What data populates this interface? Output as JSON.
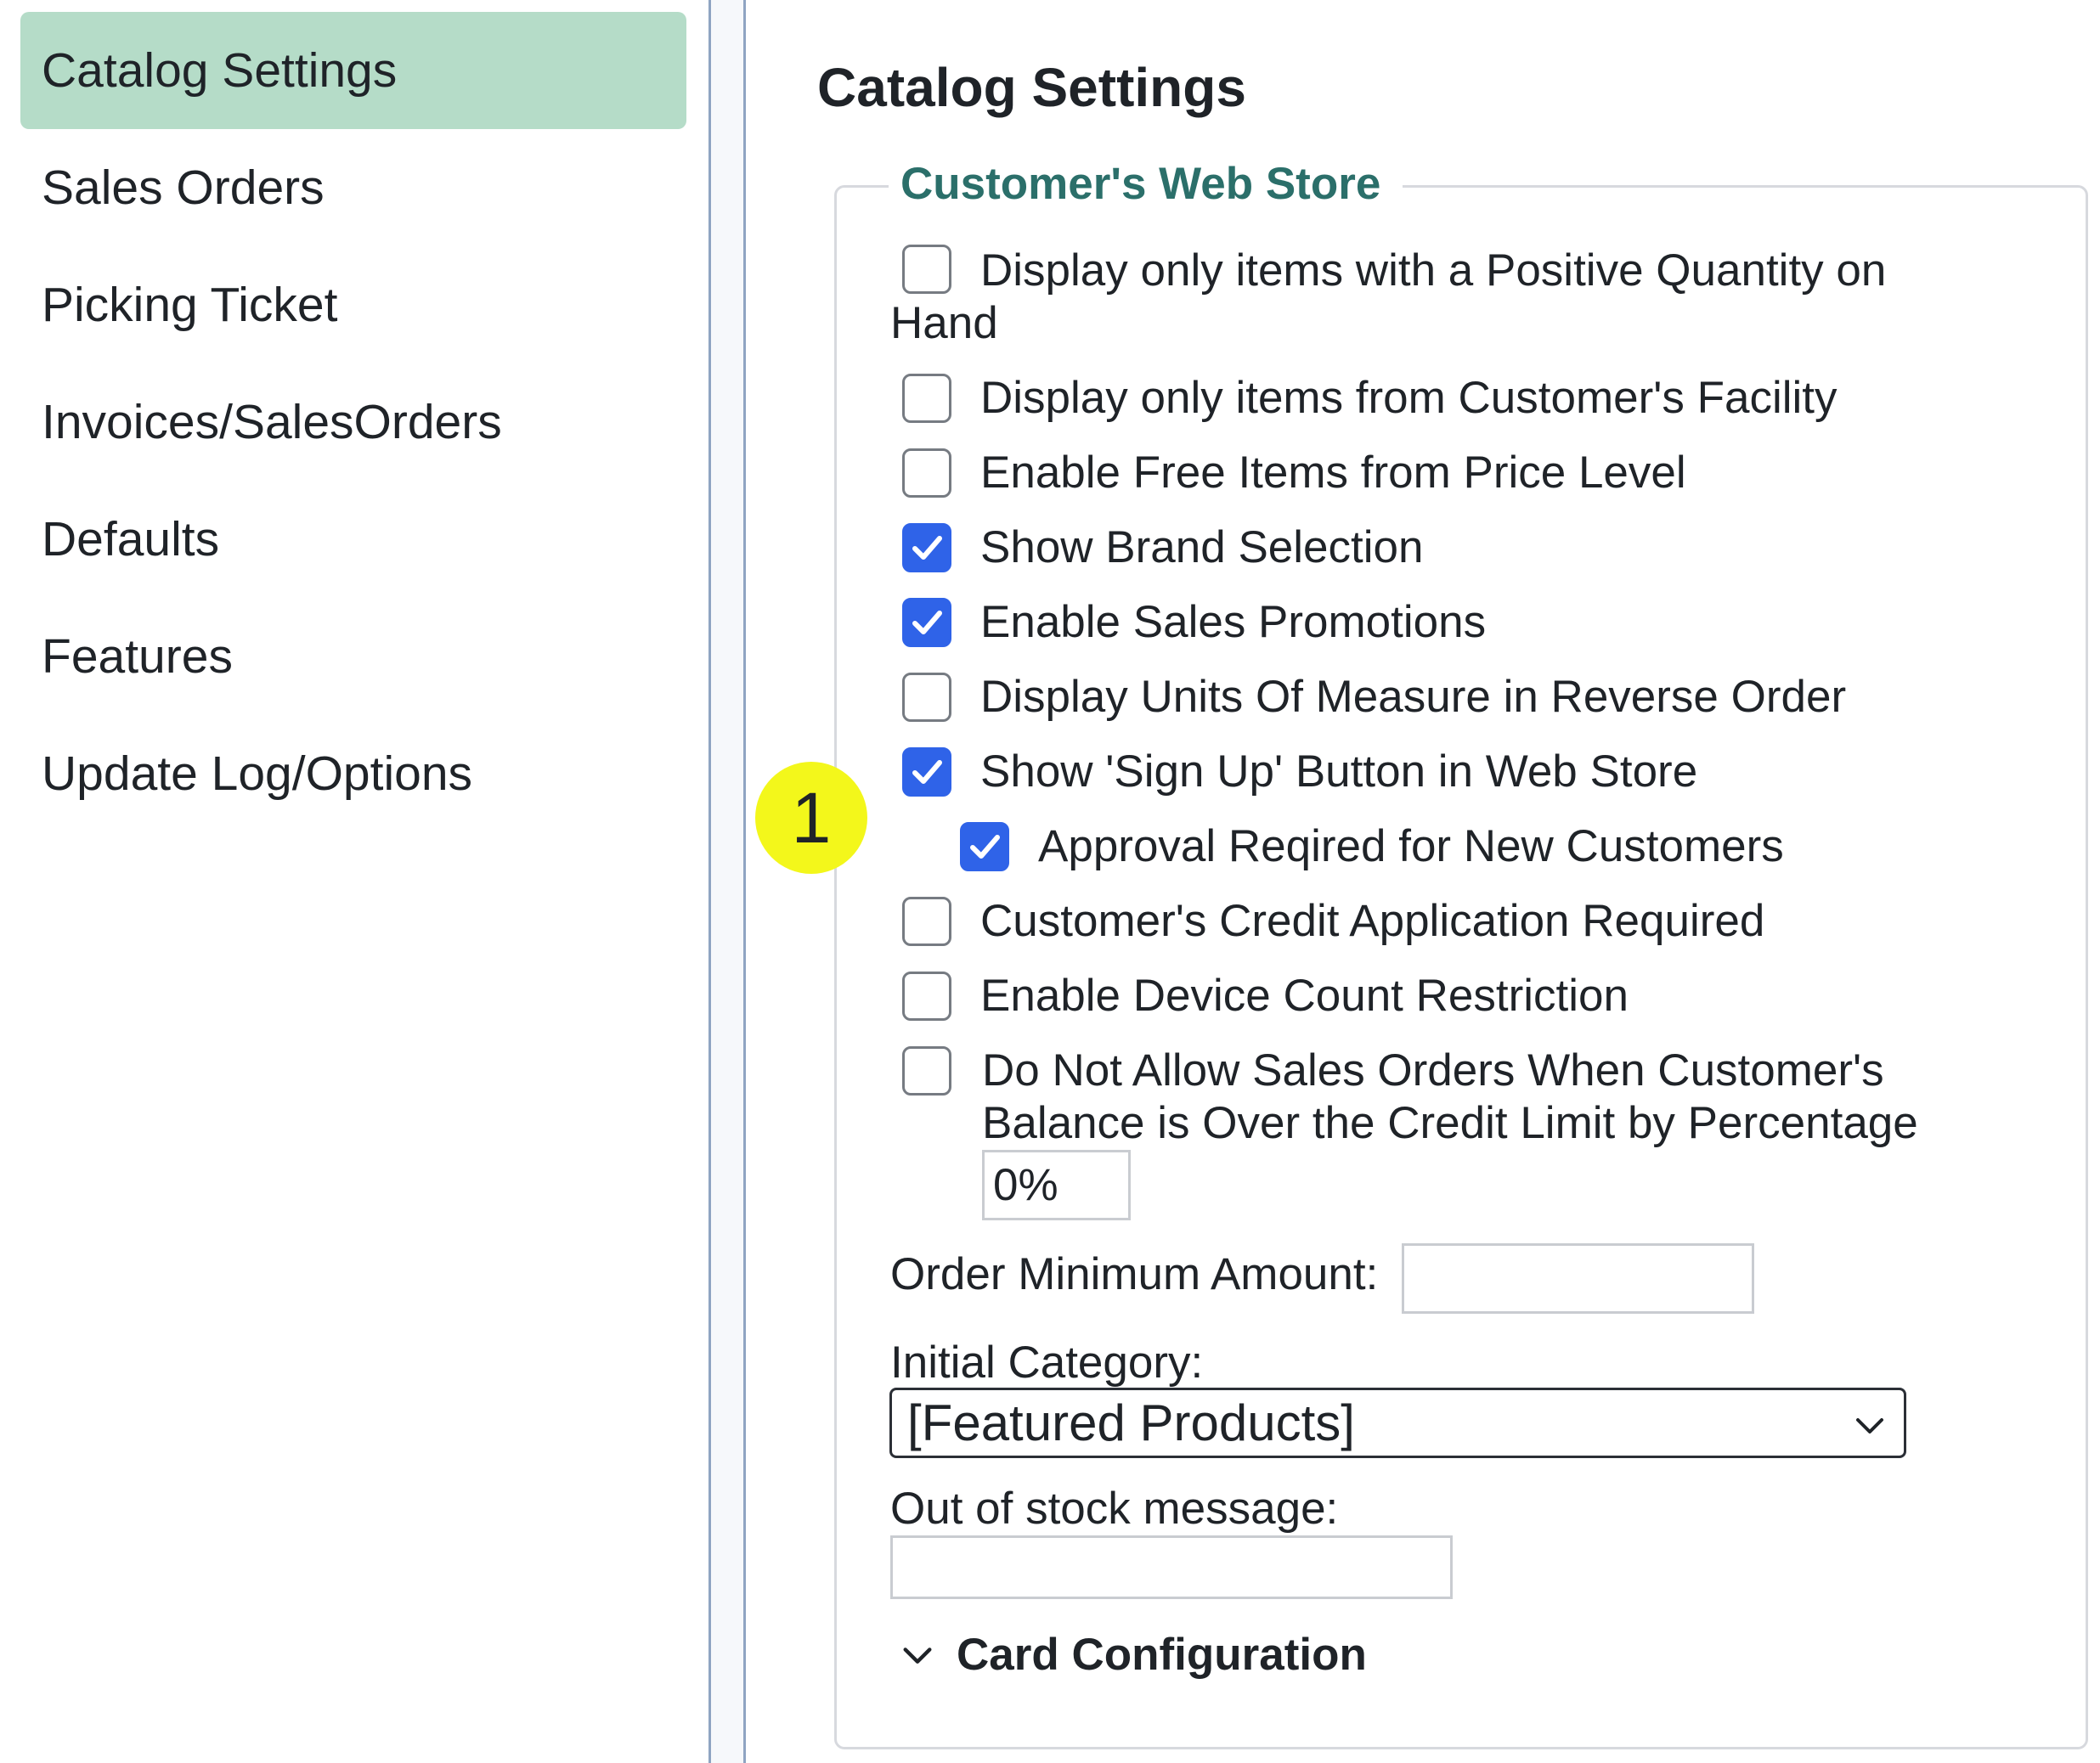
{
  "sidebar": {
    "items": [
      {
        "label": "Catalog Settings",
        "active": true
      },
      {
        "label": "Sales Orders"
      },
      {
        "label": "Picking Ticket"
      },
      {
        "label": "Invoices/SalesOrders"
      },
      {
        "label": "Defaults"
      },
      {
        "label": "Features"
      },
      {
        "label": "Update Log/Options"
      }
    ]
  },
  "main": {
    "title": "Catalog Settings",
    "section": {
      "legend": "Customer's Web Store",
      "options": [
        {
          "line1": "Display only items with a Positive Quantity on",
          "line2": "Hand",
          "checked": false
        },
        {
          "label": "Display only items from Customer's Facility",
          "checked": false
        },
        {
          "label": "Enable Free Items from Price Level",
          "checked": false
        },
        {
          "label": "Show Brand Selection",
          "checked": true
        },
        {
          "label": "Enable Sales Promotions",
          "checked": true
        },
        {
          "label": "Display Units Of Measure in Reverse Order",
          "checked": false
        },
        {
          "label": "Show 'Sign Up' Button in Web Store",
          "checked": true
        },
        {
          "label": "Approval Reqired for New Customers",
          "checked": true
        },
        {
          "label": "Customer's Credit Application Required",
          "checked": false
        },
        {
          "label": "Enable Device Count Restriction",
          "checked": false
        },
        {
          "line1": "Do Not Allow Sales Orders When Customer's",
          "line2": "Balance is Over the Credit Limit by Percentage",
          "checked": false,
          "value": "0%"
        }
      ],
      "order_minimum": {
        "label": "Order Minimum Amount:",
        "value": ""
      },
      "initial_category": {
        "label": "Initial Category:",
        "selected": "[Featured Products]"
      },
      "out_of_stock": {
        "label": "Out of stock message:",
        "value": ""
      },
      "card_configuration": {
        "label": "Card Configuration",
        "expanded": true
      }
    }
  },
  "annotation": {
    "badge": "1"
  },
  "colors": {
    "nav_active_bg": "#b5dcc8",
    "legend_text": "#2b6f6a",
    "checkbox_checked": "#2f63e8",
    "badge_bg": "#f3f71b"
  }
}
